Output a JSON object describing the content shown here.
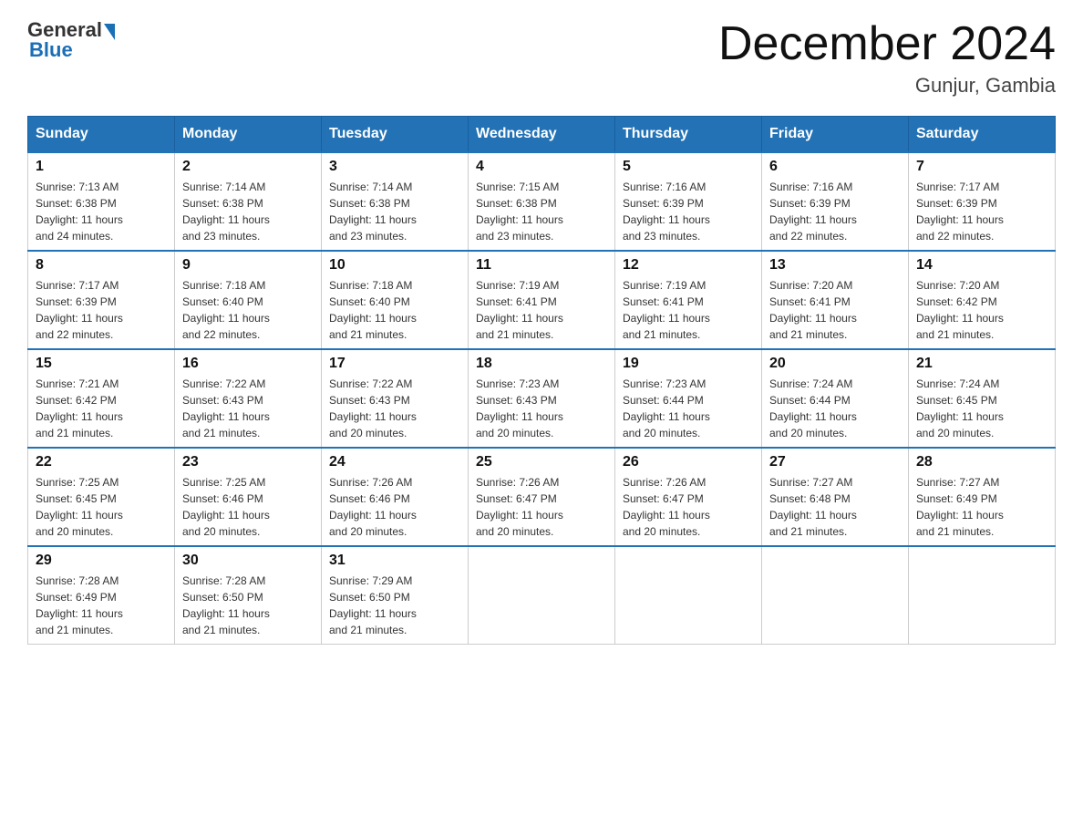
{
  "header": {
    "logo_general": "General",
    "logo_blue": "Blue",
    "main_title": "December 2024",
    "subtitle": "Gunjur, Gambia"
  },
  "calendar": {
    "days_of_week": [
      "Sunday",
      "Monday",
      "Tuesday",
      "Wednesday",
      "Thursday",
      "Friday",
      "Saturday"
    ],
    "weeks": [
      [
        {
          "day": "1",
          "sunrise": "7:13 AM",
          "sunset": "6:38 PM",
          "daylight": "11 hours and 24 minutes."
        },
        {
          "day": "2",
          "sunrise": "7:14 AM",
          "sunset": "6:38 PM",
          "daylight": "11 hours and 23 minutes."
        },
        {
          "day": "3",
          "sunrise": "7:14 AM",
          "sunset": "6:38 PM",
          "daylight": "11 hours and 23 minutes."
        },
        {
          "day": "4",
          "sunrise": "7:15 AM",
          "sunset": "6:38 PM",
          "daylight": "11 hours and 23 minutes."
        },
        {
          "day": "5",
          "sunrise": "7:16 AM",
          "sunset": "6:39 PM",
          "daylight": "11 hours and 23 minutes."
        },
        {
          "day": "6",
          "sunrise": "7:16 AM",
          "sunset": "6:39 PM",
          "daylight": "11 hours and 22 minutes."
        },
        {
          "day": "7",
          "sunrise": "7:17 AM",
          "sunset": "6:39 PM",
          "daylight": "11 hours and 22 minutes."
        }
      ],
      [
        {
          "day": "8",
          "sunrise": "7:17 AM",
          "sunset": "6:39 PM",
          "daylight": "11 hours and 22 minutes."
        },
        {
          "day": "9",
          "sunrise": "7:18 AM",
          "sunset": "6:40 PM",
          "daylight": "11 hours and 22 minutes."
        },
        {
          "day": "10",
          "sunrise": "7:18 AM",
          "sunset": "6:40 PM",
          "daylight": "11 hours and 21 minutes."
        },
        {
          "day": "11",
          "sunrise": "7:19 AM",
          "sunset": "6:41 PM",
          "daylight": "11 hours and 21 minutes."
        },
        {
          "day": "12",
          "sunrise": "7:19 AM",
          "sunset": "6:41 PM",
          "daylight": "11 hours and 21 minutes."
        },
        {
          "day": "13",
          "sunrise": "7:20 AM",
          "sunset": "6:41 PM",
          "daylight": "11 hours and 21 minutes."
        },
        {
          "day": "14",
          "sunrise": "7:20 AM",
          "sunset": "6:42 PM",
          "daylight": "11 hours and 21 minutes."
        }
      ],
      [
        {
          "day": "15",
          "sunrise": "7:21 AM",
          "sunset": "6:42 PM",
          "daylight": "11 hours and 21 minutes."
        },
        {
          "day": "16",
          "sunrise": "7:22 AM",
          "sunset": "6:43 PM",
          "daylight": "11 hours and 21 minutes."
        },
        {
          "day": "17",
          "sunrise": "7:22 AM",
          "sunset": "6:43 PM",
          "daylight": "11 hours and 20 minutes."
        },
        {
          "day": "18",
          "sunrise": "7:23 AM",
          "sunset": "6:43 PM",
          "daylight": "11 hours and 20 minutes."
        },
        {
          "day": "19",
          "sunrise": "7:23 AM",
          "sunset": "6:44 PM",
          "daylight": "11 hours and 20 minutes."
        },
        {
          "day": "20",
          "sunrise": "7:24 AM",
          "sunset": "6:44 PM",
          "daylight": "11 hours and 20 minutes."
        },
        {
          "day": "21",
          "sunrise": "7:24 AM",
          "sunset": "6:45 PM",
          "daylight": "11 hours and 20 minutes."
        }
      ],
      [
        {
          "day": "22",
          "sunrise": "7:25 AM",
          "sunset": "6:45 PM",
          "daylight": "11 hours and 20 minutes."
        },
        {
          "day": "23",
          "sunrise": "7:25 AM",
          "sunset": "6:46 PM",
          "daylight": "11 hours and 20 minutes."
        },
        {
          "day": "24",
          "sunrise": "7:26 AM",
          "sunset": "6:46 PM",
          "daylight": "11 hours and 20 minutes."
        },
        {
          "day": "25",
          "sunrise": "7:26 AM",
          "sunset": "6:47 PM",
          "daylight": "11 hours and 20 minutes."
        },
        {
          "day": "26",
          "sunrise": "7:26 AM",
          "sunset": "6:47 PM",
          "daylight": "11 hours and 20 minutes."
        },
        {
          "day": "27",
          "sunrise": "7:27 AM",
          "sunset": "6:48 PM",
          "daylight": "11 hours and 21 minutes."
        },
        {
          "day": "28",
          "sunrise": "7:27 AM",
          "sunset": "6:49 PM",
          "daylight": "11 hours and 21 minutes."
        }
      ],
      [
        {
          "day": "29",
          "sunrise": "7:28 AM",
          "sunset": "6:49 PM",
          "daylight": "11 hours and 21 minutes."
        },
        {
          "day": "30",
          "sunrise": "7:28 AM",
          "sunset": "6:50 PM",
          "daylight": "11 hours and 21 minutes."
        },
        {
          "day": "31",
          "sunrise": "7:29 AM",
          "sunset": "6:50 PM",
          "daylight": "11 hours and 21 minutes."
        },
        null,
        null,
        null,
        null
      ]
    ],
    "labels": {
      "sunrise": "Sunrise:",
      "sunset": "Sunset:",
      "daylight": "Daylight:"
    }
  }
}
